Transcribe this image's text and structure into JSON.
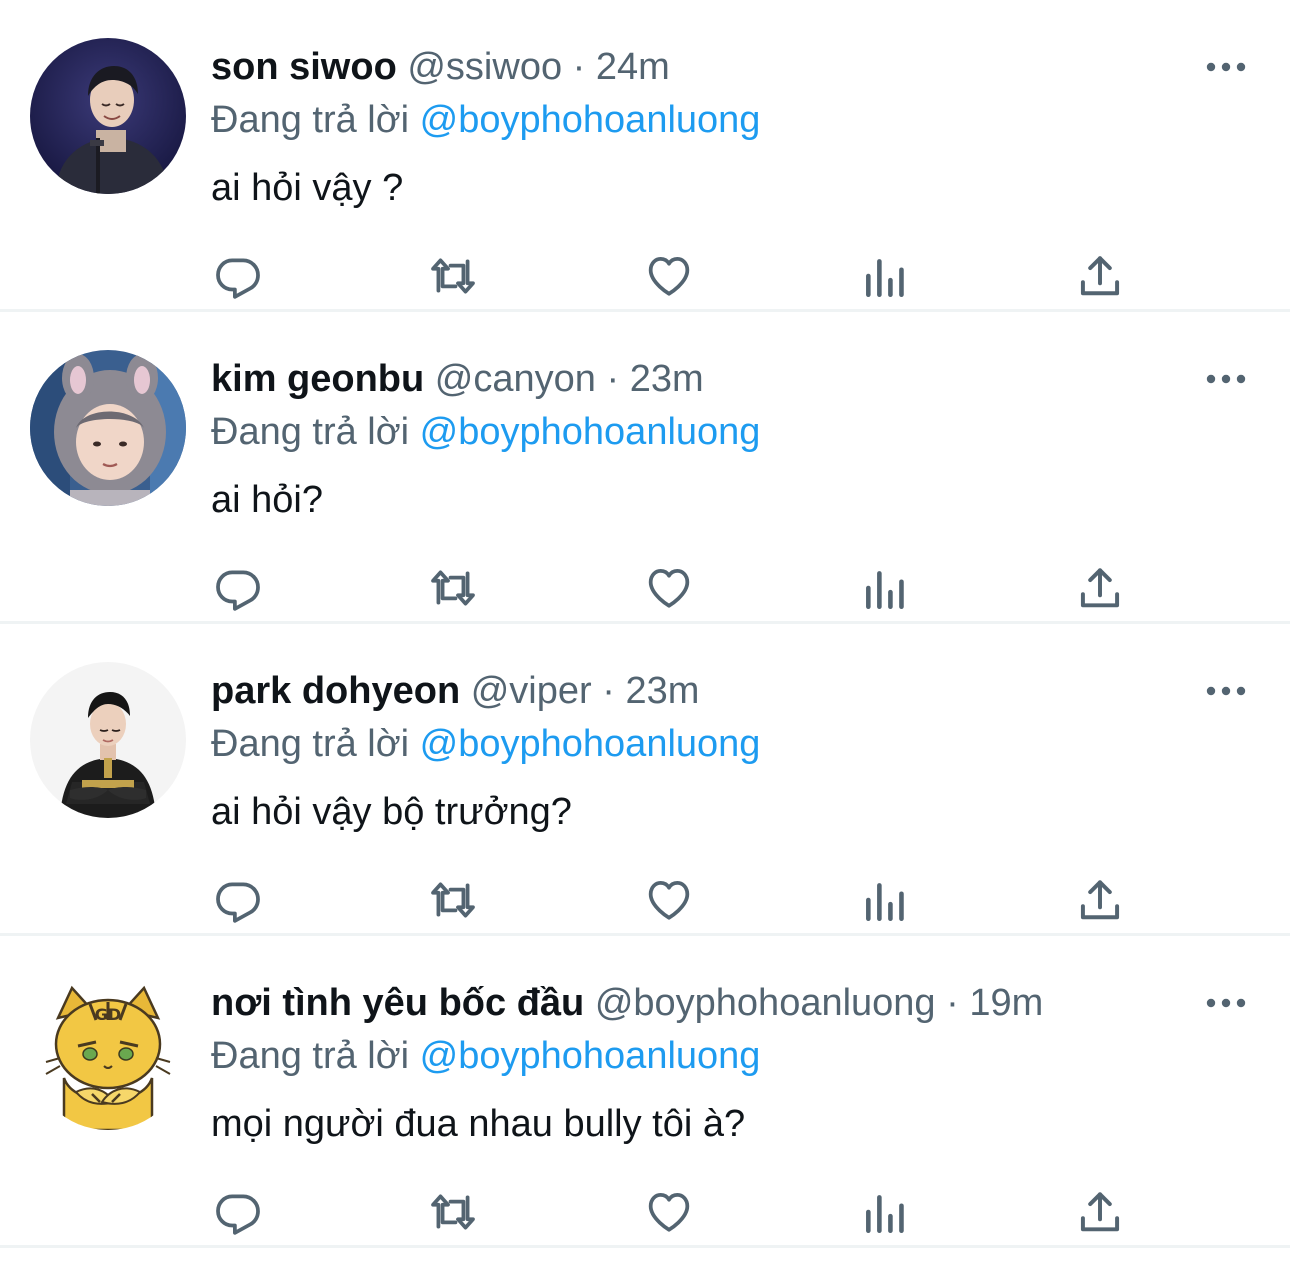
{
  "replies": [
    {
      "display_name": "son siwoo",
      "handle": "@ssiwoo",
      "separator": "·",
      "time": "24m",
      "reply_prefix": "Đang trả lời",
      "reply_to": "@boyphohoanluong",
      "text": "ai hỏi vậy ?",
      "avatar": "photo-man-at-podium"
    },
    {
      "display_name": "kim geonbu",
      "handle": "@canyon",
      "separator": "·",
      "time": "23m",
      "reply_prefix": "Đang trả lời",
      "reply_to": "@boyphohoanluong",
      "text": "ai hỏi?",
      "avatar": "photo-person-in-animal-hood"
    },
    {
      "display_name": "park dohyeon",
      "handle": "@viper",
      "separator": "·",
      "time": "23m",
      "reply_prefix": "Đang trả lời",
      "reply_to": "@boyphohoanluong",
      "text": "ai hỏi vậy bộ trưởng?",
      "avatar": "photo-player-in-team-jacket"
    },
    {
      "display_name": "nơi tình yêu bốc đầu",
      "handle": "@boyphohoanluong",
      "separator": "·",
      "time": "19m",
      "reply_prefix": "Đang trả lời",
      "reply_to": "@boyphohoanluong",
      "text": "mọi người đua nhau bully tôi à?",
      "avatar": "cartoon-tiger-cat-sticker"
    }
  ],
  "action_icons": [
    "reply-icon",
    "retweet-icon",
    "like-icon",
    "views-icon",
    "share-icon"
  ],
  "colors": {
    "mention": "#1d9bf0",
    "secondary_text": "#536471",
    "primary_text": "#0f1419",
    "divider": "#eff3f4"
  }
}
